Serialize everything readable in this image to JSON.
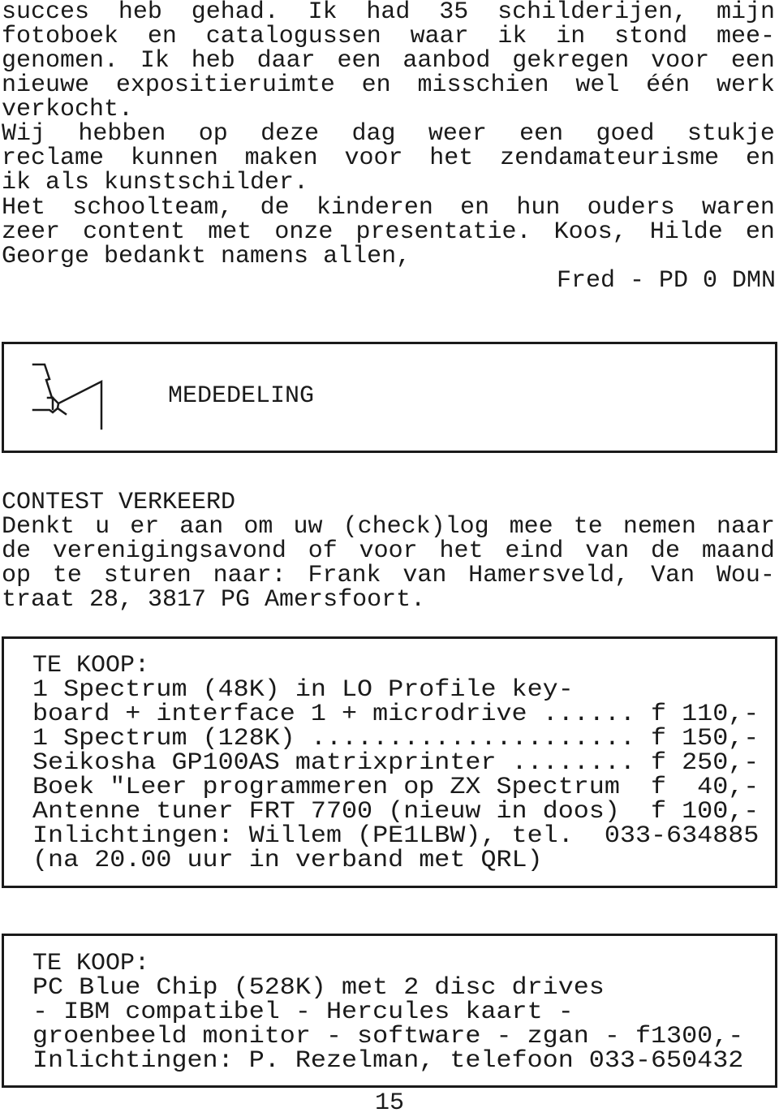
{
  "article": {
    "paragraph1": [
      [
        "succes",
        "heb",
        "gehad.",
        "Ik",
        "had",
        "35",
        "schilderijen,",
        "mijn"
      ],
      [
        "fotoboek",
        "en",
        "catalogussen",
        "waar",
        "ik",
        "in",
        "stond",
        "mee-"
      ],
      [
        "genomen.",
        "Ik",
        "heb",
        "daar",
        "een",
        "aanbod",
        "gekregen",
        "voor",
        "een"
      ],
      [
        "nieuwe",
        "expositieruimte",
        "en",
        "misschien",
        "wel",
        "één",
        "werk"
      ]
    ],
    "paragraph1_last": "verkocht.",
    "paragraph2": [
      [
        "Wij",
        "hebben",
        "op",
        "deze",
        "dag",
        "weer",
        "een",
        "goed",
        "stukje"
      ],
      [
        "reclame",
        "kunnen",
        "maken",
        "voor",
        "het",
        "zendamateurisme",
        "en"
      ]
    ],
    "paragraph2_last": "ik als kunstschilder.",
    "paragraph3": [
      [
        "Het",
        "schoolteam,",
        "de",
        "kinderen",
        "en",
        "hun",
        "ouders",
        "waren"
      ],
      [
        "zeer",
        "content",
        "met",
        "onze",
        "presentatie.",
        "Koos,",
        "Hilde",
        "en"
      ]
    ],
    "paragraph3_last": "George bedankt namens allen,",
    "signature": "Fred - PD 0 DMN"
  },
  "announcement": {
    "title": "MEDEDELING",
    "icon": "hand-pointing-icon"
  },
  "contest": {
    "heading": "CONTEST VERKEERD",
    "lines": [
      [
        "Denkt",
        "u",
        "er",
        "aan",
        "om",
        "uw",
        "(check)log",
        "mee",
        "te",
        "nemen",
        "naar"
      ],
      [
        "de",
        "verenigingsavond",
        "of",
        "voor",
        "het",
        "eind",
        "van",
        "de",
        "maand"
      ],
      [
        "op",
        "te",
        "sturen",
        "naar:",
        "Frank",
        "van",
        "Hamersveld,",
        "Van",
        "Wou-"
      ]
    ],
    "last": "traat 28, 3817 PG Amersfoort."
  },
  "ad1": {
    "heading": "TE KOOP:",
    "lines": [
      "1 Spectrum (48K) in LO Profile key-",
      "board + interface 1 + microdrive ...... f 110,-",
      "1 Spectrum (128K) ..................... f 150,-",
      "Seikosha GP100AS matrixprinter ........ f 250,-",
      "Boek \"Leer programmeren op ZX Spectrum  f  40,-",
      "Antenne tuner FRT 7700 (nieuw in doos)  f 100,-",
      "Inlichtingen: Willem (PE1LBW), tel.  033-634885",
      "(na 20.00 uur in verband met QRL)"
    ]
  },
  "ad2": {
    "heading": "TE KOOP:",
    "lines": [
      "PC Blue Chip (528K) met 2 disc drives",
      "- IBM compatibel - Hercules kaart -",
      "groenbeeld monitor - software - zgan - f1300,-",
      "Inlichtingen: P. Rezelman, telefoon 033-650432"
    ]
  },
  "page_number": "15"
}
